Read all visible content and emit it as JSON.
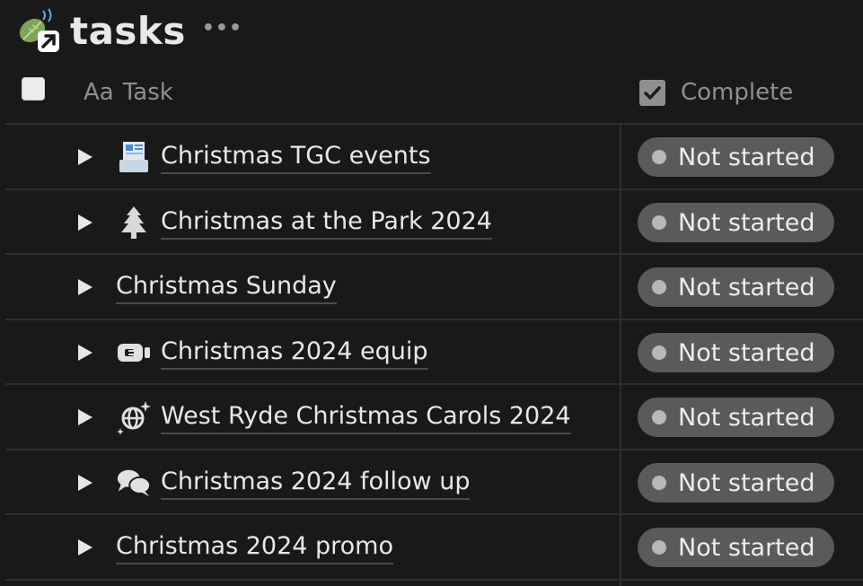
{
  "database": {
    "title": "tasks",
    "icon": "leaf-link-icon",
    "more_label": "•••"
  },
  "columns": {
    "task": {
      "icon": "text-aa-icon",
      "icon_text": "Aa",
      "label": "Task"
    },
    "complete": {
      "icon": "checkbox-icon",
      "label": "Complete"
    }
  },
  "rows": [
    {
      "title": "Christmas TGC events",
      "icon": "newspaper-icon",
      "status": "Not started"
    },
    {
      "title": "Christmas at the Park 2024",
      "icon": "christmas-tree-icon",
      "status": "Not started"
    },
    {
      "title": "Christmas Sunday",
      "icon": "",
      "status": "Not started"
    },
    {
      "title": "Christmas 2024 equip",
      "icon": "plug-icon",
      "status": "Not started"
    },
    {
      "title": "West Ryde Christmas Carols 2024",
      "icon": "globe-sparkle-icon",
      "status": "Not started"
    },
    {
      "title": "Christmas 2024 follow up",
      "icon": "chat-bubbles-icon",
      "status": "Not started"
    },
    {
      "title": "Christmas 2024 promo",
      "icon": "",
      "status": "Not started"
    }
  ],
  "colors": {
    "background": "#191919",
    "status_pill": "#5a5a5a",
    "status_dot": "#b8b8b8",
    "divider": "#2f2f2f"
  }
}
